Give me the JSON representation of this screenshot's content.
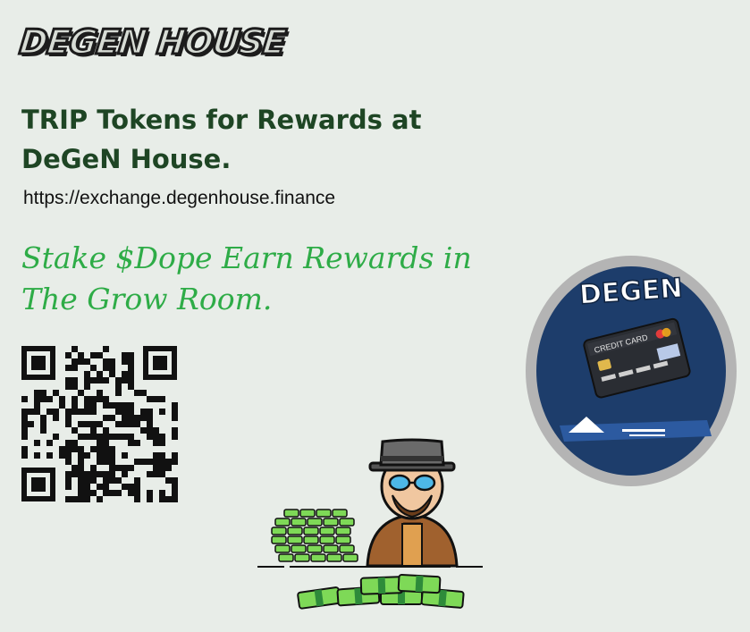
{
  "brand": {
    "logo_text": "DEGEN HOUSE"
  },
  "headline": "TRIP Tokens for Rewards at DeGeN House.",
  "url": "https://exchange.degenhouse.finance",
  "tagline": "Stake $Dope Earn Rewards in The Grow Room.",
  "badge": {
    "title": "DEGEN",
    "card_label": "CREDIT CARD"
  },
  "icons": {
    "qr": "qr-code-icon",
    "badge": "degen-credit-card-badge",
    "mascot": "hat-man-with-cash-illustration"
  },
  "colors": {
    "background": "#e8ede8",
    "headline": "#1e4524",
    "tagline": "#2eac47",
    "badge_ring": "#b4b4b4",
    "badge_fill": "#1d3d6b",
    "cash": "#7ed957"
  }
}
